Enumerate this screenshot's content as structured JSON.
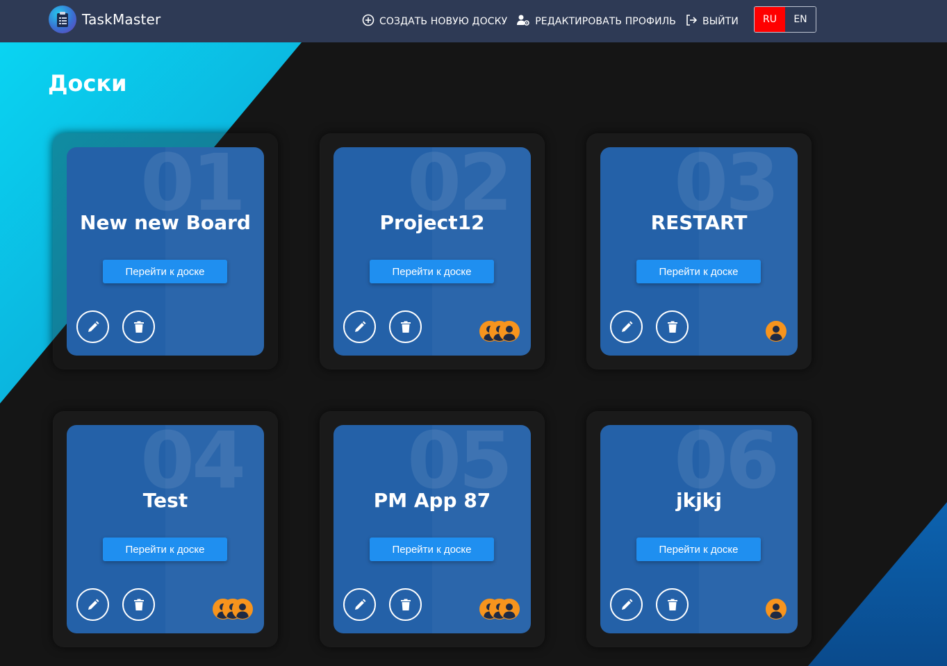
{
  "app": {
    "name": "TaskMaster"
  },
  "nav": {
    "create_board": "СОЗДАТЬ НОВУЮ ДОСКУ",
    "edit_profile": "РЕДАКТИРОВАТЬ ПРОФИЛЬ",
    "logout": "ВЫЙТИ",
    "lang_ru": "RU",
    "lang_en": "EN",
    "active_lang": "RU"
  },
  "page": {
    "title": "Доски"
  },
  "colors": {
    "navbar": "#2e3a55",
    "card": "#2461a8",
    "button": "#1f8ff0",
    "member_avatar": "#f7941d",
    "lang_active": "#ff0000"
  },
  "boards": [
    {
      "number": "01",
      "title": "New new Board",
      "go_label": "Перейти к доске",
      "members": 0
    },
    {
      "number": "02",
      "title": "Project12",
      "go_label": "Перейти к доске",
      "members": 3
    },
    {
      "number": "03",
      "title": "RESTART",
      "go_label": "Перейти к доске",
      "members": 1
    },
    {
      "number": "04",
      "title": "Test",
      "go_label": "Перейти к доске",
      "members": 3
    },
    {
      "number": "05",
      "title": "PM App 87",
      "go_label": "Перейти к доске",
      "members": 3
    },
    {
      "number": "06",
      "title": "jkjkj",
      "go_label": "Перейти к доске",
      "members": 1
    }
  ],
  "icons": {
    "create": "plus-circle-icon",
    "profile": "user-gear-icon",
    "logout": "sign-out-icon",
    "edit": "pencil-icon",
    "delete": "trash-icon",
    "member": "user-avatar-icon"
  }
}
